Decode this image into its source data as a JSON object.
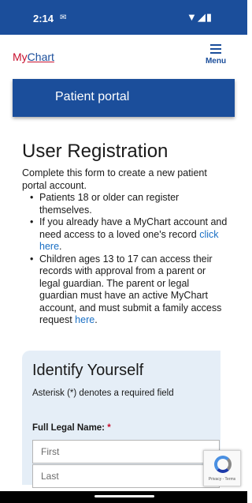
{
  "status_bar": {
    "time": "2:14",
    "notification_icon": "notification-icon",
    "right_icons": "wifi-signal-battery-icons"
  },
  "header": {
    "logo_my": "My",
    "logo_chart": "Chart",
    "menu_label": "Menu"
  },
  "portal": {
    "title": "Patient portal"
  },
  "page": {
    "title": "User Registration",
    "intro": "Complete this form to create a new patient portal account.",
    "bullets": [
      {
        "text": "Patients 18 or older can register themselves.",
        "link": ""
      },
      {
        "text": "If you already have a MyChart account and need access to a loved one's record ",
        "link": "click here",
        "suffix": "."
      },
      {
        "text": "Children ages 13 to 17 can access their records with approval from a parent or legal guardian. The parent or legal guardian must have an active MyChart account, and must submit a family access request ",
        "link": "here",
        "suffix": "."
      }
    ]
  },
  "form": {
    "title": "Identify Yourself",
    "note": "Asterisk (*) denotes a required field",
    "full_name_label": "Full Legal Name:",
    "required_marker": "*",
    "first_placeholder": "First",
    "last_placeholder": "Last"
  },
  "recaptcha": {
    "text": "Privacy - Terms"
  },
  "colors": {
    "brand_blue": "#1b4e9b",
    "brand_red": "#c8102e",
    "link_blue": "#1a6fc4",
    "card_bg": "#e5eef7"
  }
}
